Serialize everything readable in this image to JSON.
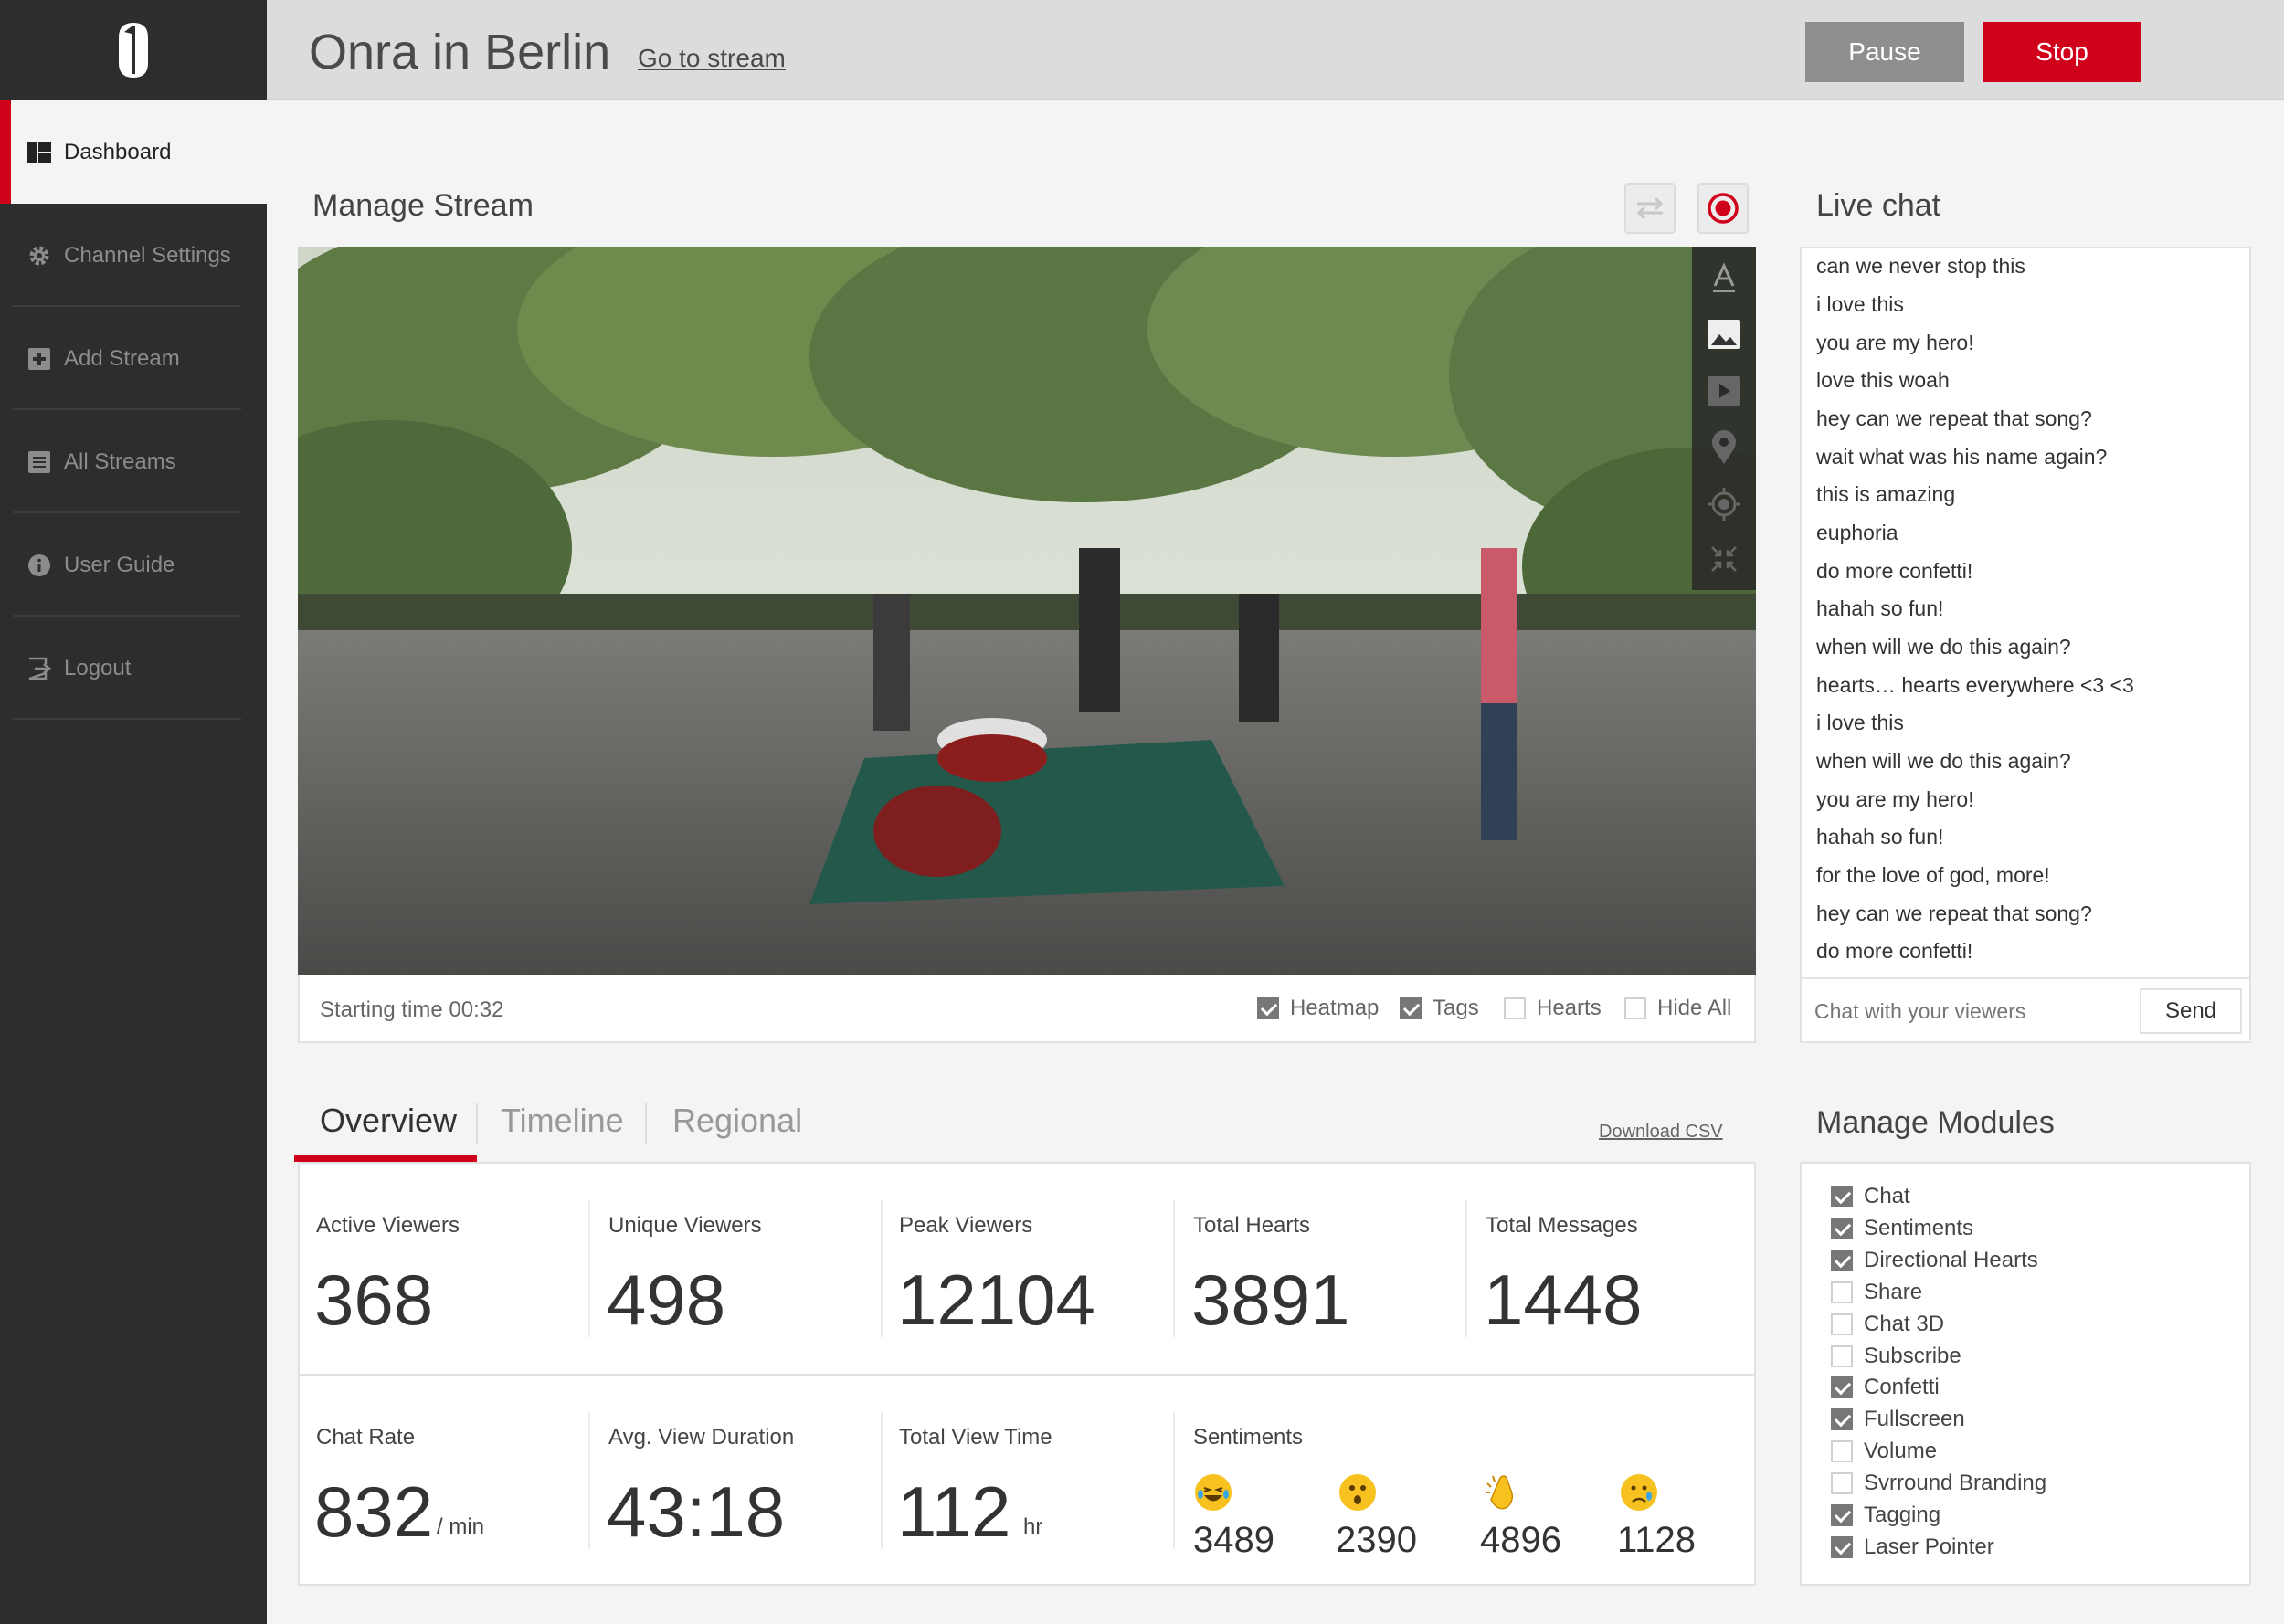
{
  "app": {
    "title": "Onra in Berlin",
    "go_link": "Go to stream",
    "pause": "Pause",
    "stop": "Stop"
  },
  "sidebar": {
    "items": [
      {
        "label": "Dashboard",
        "icon": "dashboard-icon",
        "active": true
      },
      {
        "label": "Channel Settings",
        "icon": "gear-icon"
      },
      {
        "label": "Add Stream",
        "icon": "plus-square-icon"
      },
      {
        "label": "All Streams",
        "icon": "list-icon"
      },
      {
        "label": "User Guide",
        "icon": "info-icon"
      },
      {
        "label": "Logout",
        "icon": "logout-icon"
      }
    ]
  },
  "stream": {
    "title": "Manage Stream",
    "starting_time": "Starting time 00:32",
    "options": [
      {
        "label": "Heatmap",
        "checked": true
      },
      {
        "label": "Tags",
        "checked": true
      },
      {
        "label": "Hearts",
        "checked": false
      },
      {
        "label": "Hide All",
        "checked": false
      }
    ]
  },
  "chat": {
    "title": "Live chat",
    "messages": [
      "can we never stop this",
      "i love this",
      "you are my hero!",
      "love this woah",
      "hey can we repeat that song?",
      "wait what was his name again?",
      "this is amazing",
      "euphoria",
      "do more confetti!",
      "hahah so fun!",
      "when will we do this again?",
      "hearts… hearts everywhere <3 <3",
      "i love this",
      "when will we do this again?",
      "you are my hero!",
      "hahah so fun!",
      "for the love of god, more!",
      "hey can we repeat that song?",
      "do more confetti!"
    ],
    "placeholder": "Chat with your viewers",
    "send": "Send"
  },
  "tabs": {
    "items": [
      "Overview",
      "Timeline",
      "Regional"
    ],
    "download": "Download CSV"
  },
  "stats": {
    "row1": [
      {
        "label": "Active Viewers",
        "value": "368"
      },
      {
        "label": "Unique Viewers",
        "value": "498"
      },
      {
        "label": "Peak Viewers",
        "value": "12104"
      },
      {
        "label": "Total Hearts",
        "value": "3891"
      },
      {
        "label": "Total Messages",
        "value": "1448"
      }
    ],
    "row2": [
      {
        "label": "Chat Rate",
        "value": "832",
        "unit": "/ min"
      },
      {
        "label": "Avg. View Duration",
        "value": "43:18"
      },
      {
        "label": "Total View Time",
        "value": "112",
        "unit": "hr"
      }
    ],
    "sentiments": {
      "label": "Sentiments",
      "items": [
        {
          "icon": "laughing-emoji-icon",
          "value": "3489"
        },
        {
          "icon": "surprised-emoji-icon",
          "value": "2390"
        },
        {
          "icon": "clapping-hands-icon",
          "value": "4896"
        },
        {
          "icon": "crying-emoji-icon",
          "value": "1128"
        }
      ]
    }
  },
  "modules": {
    "title": "Manage Modules",
    "items": [
      {
        "label": "Chat",
        "checked": true
      },
      {
        "label": "Sentiments",
        "checked": true
      },
      {
        "label": "Directional Hearts",
        "checked": true
      },
      {
        "label": "Share",
        "checked": false
      },
      {
        "label": "Chat 3D",
        "checked": false
      },
      {
        "label": "Subscribe",
        "checked": false
      },
      {
        "label": "Confetti",
        "checked": true
      },
      {
        "label": "Fullscreen",
        "checked": true
      },
      {
        "label": "Volume",
        "checked": false
      },
      {
        "label": "Svrround Branding",
        "checked": false
      },
      {
        "label": "Tagging",
        "checked": true
      },
      {
        "label": "Laser Pointer",
        "checked": true
      }
    ]
  },
  "colors": {
    "accent": "#d0021b",
    "sidebar": "#2d2d2d",
    "pause": "#8e8e8e"
  }
}
